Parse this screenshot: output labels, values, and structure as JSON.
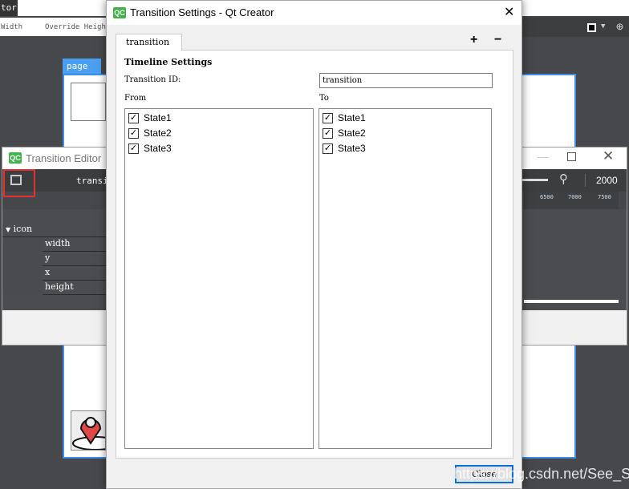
{
  "designer": {
    "tab_label": "tor",
    "props": [
      "Width",
      "Override Height"
    ],
    "page_label": "page"
  },
  "transition_editor": {
    "title": "Transition Editor",
    "transition_label": "transi",
    "zoom_value": "2000",
    "ruler_ticks": [
      "6500",
      "7000",
      "7500"
    ],
    "tree": {
      "target": "icon",
      "properties": [
        "width",
        "y",
        "x",
        "height"
      ]
    }
  },
  "dialog": {
    "title": "Transition Settings - Qt Creator",
    "tab": "transition",
    "add_label": "+",
    "remove_label": "−",
    "section": "Timeline Settings",
    "id_label": "Transition ID:",
    "id_value": "transition",
    "from_label": "From",
    "to_label": "To",
    "from_states": [
      {
        "label": "State1",
        "checked": true
      },
      {
        "label": "State2",
        "checked": true
      },
      {
        "label": "State3",
        "checked": true
      }
    ],
    "to_states": [
      {
        "label": "State1",
        "checked": true
      },
      {
        "label": "State2",
        "checked": true
      },
      {
        "label": "State3",
        "checked": true
      }
    ],
    "close_label": "Close"
  },
  "watermark": "https://blog.csdn.net/See_Star"
}
